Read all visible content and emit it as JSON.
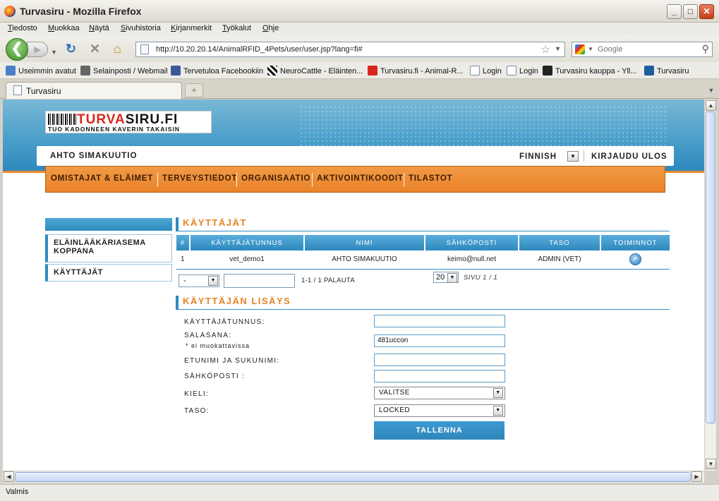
{
  "window": {
    "title": "Turvasiru - Mozilla Firefox",
    "min": "_",
    "max": "□",
    "close": "✕"
  },
  "menu": [
    "Tiedosto",
    "Muokkaa",
    "Näytä",
    "Sivuhistoria",
    "Kirjanmerkit",
    "Työkalut",
    "Ohje"
  ],
  "nav": {
    "url": "http://10.20.20.14/AnimalRFID_4Pets/user/user.jsp?lang=fi#",
    "search_placeholder": "Google"
  },
  "bookmarks": [
    "Useimmin avatut",
    "Selainposti / Webmail",
    "Tervetuloa Facebookiin",
    "NeuroCattle - Eläinten...",
    "Turvasiru.fi - Animal-R...",
    "Login",
    "Login",
    "Turvasiru kauppa - Yll...",
    "Turvasiru"
  ],
  "tab": {
    "label": "Turvasiru",
    "new_tab": "+"
  },
  "site": {
    "logo_prefix": "TURVA",
    "logo_suffix": "SIRU.FI",
    "tagline": "TUO KADONNEEN KAVERIN TAKAISIN",
    "user_name": "AHTO SIMAKUUTIO",
    "language": "FINNISH",
    "logout": "KIRJAUDU ULOS",
    "main_nav": [
      "OMISTAJAT & ELÄIMET",
      "TERVEYSTIEDOT",
      "ORGANISAATIO",
      "AKTIVOINTIKOODIT",
      "TILASTOT"
    ]
  },
  "sidebar": {
    "items": [
      "ELÄINLÄÄKÄRIASEMA KOPPANA",
      "KÄYTTÄJÄT"
    ]
  },
  "users": {
    "title": "KÄYTTÄJÄT",
    "columns": [
      "#",
      "KÄYTTÄJÄTUNNUS",
      "NIMI",
      "SÄHKÖPOSTI",
      "TASO",
      "TOIMINNOT"
    ],
    "rows": [
      {
        "num": "1",
        "username": "vet_demo1",
        "name": "AHTO SIMAKUUTIO",
        "email": "keimo@null.net",
        "level": "ADMIN (VET)"
      }
    ],
    "filter_value": "-",
    "count": "1-1 / 1 PALAUTA",
    "per_page": "20",
    "page_info": "SIVU 1 / 1"
  },
  "add_user": {
    "title": "KÄYTTÄJÄN LISÄYS",
    "username_label": "KÄYTTÄJÄTUNNUS:",
    "password_label": "SALASANA:",
    "password_note": "* ei muokattavissa",
    "password_value": "481uccon",
    "fullname_label": "ETUNIMI JA SUKUNIMI:",
    "email_label": "SÄHKÖPOSTI :",
    "language_label": "KIELI:",
    "language_value": "VALITSE",
    "level_label": "TASO:",
    "level_value": "LOCKED",
    "save_label": "TALLENNA"
  },
  "status": "Valmis"
}
